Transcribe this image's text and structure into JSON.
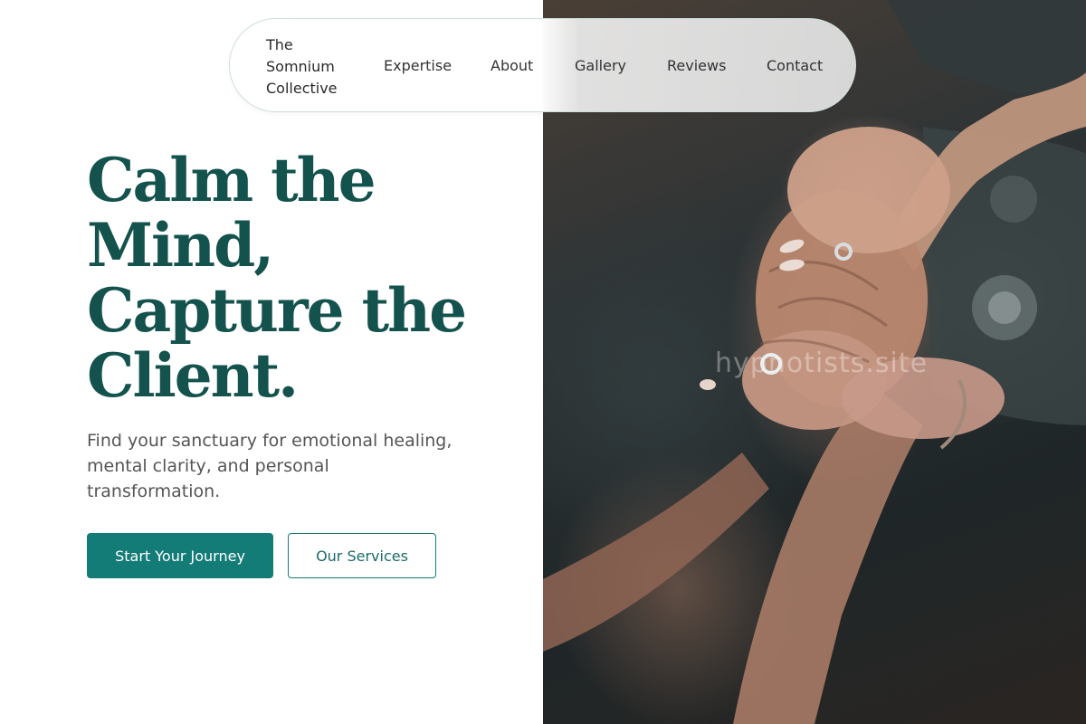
{
  "nav": {
    "brand": "The Somnium Collective",
    "items": [
      {
        "label": "Expertise"
      },
      {
        "label": "About"
      },
      {
        "label": "Gallery"
      },
      {
        "label": "Reviews"
      },
      {
        "label": "Contact"
      }
    ]
  },
  "hero": {
    "headline": "Calm the Mind, Capture the Client.",
    "subtitle": "Find your sanctuary for emotional healing, mental clarity, and personal transformation.",
    "primary_button": "Start Your Journey",
    "secondary_button": "Our Services"
  },
  "image": {
    "watermark": "hypnotists.site",
    "alt": "Two people holding hands"
  },
  "colors": {
    "accent": "#147c77",
    "headline": "#14524d",
    "body_text": "#555555"
  }
}
